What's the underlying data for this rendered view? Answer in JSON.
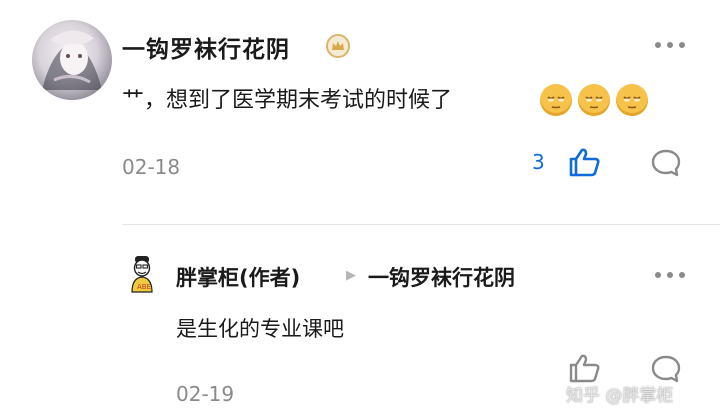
{
  "comment1": {
    "author": "一钩罗袜行花阴",
    "text": "艹，想到了医学期末考试的时候了",
    "emojis": [
      "sleepy-face-emoji",
      "sleepy-face-emoji",
      "sleepy-face-emoji"
    ],
    "date": "02-18",
    "like_count": "3"
  },
  "reply": {
    "author": "胖掌柜(作者)",
    "reply_to": "一钩罗袜行花阴",
    "text": "是生化的专业课吧",
    "date": "02-19"
  },
  "watermark": "知乎 @胖掌柜",
  "colors": {
    "accent": "#0f6bd8",
    "muted": "#8a8a8a",
    "badge": "#d9b46b"
  }
}
